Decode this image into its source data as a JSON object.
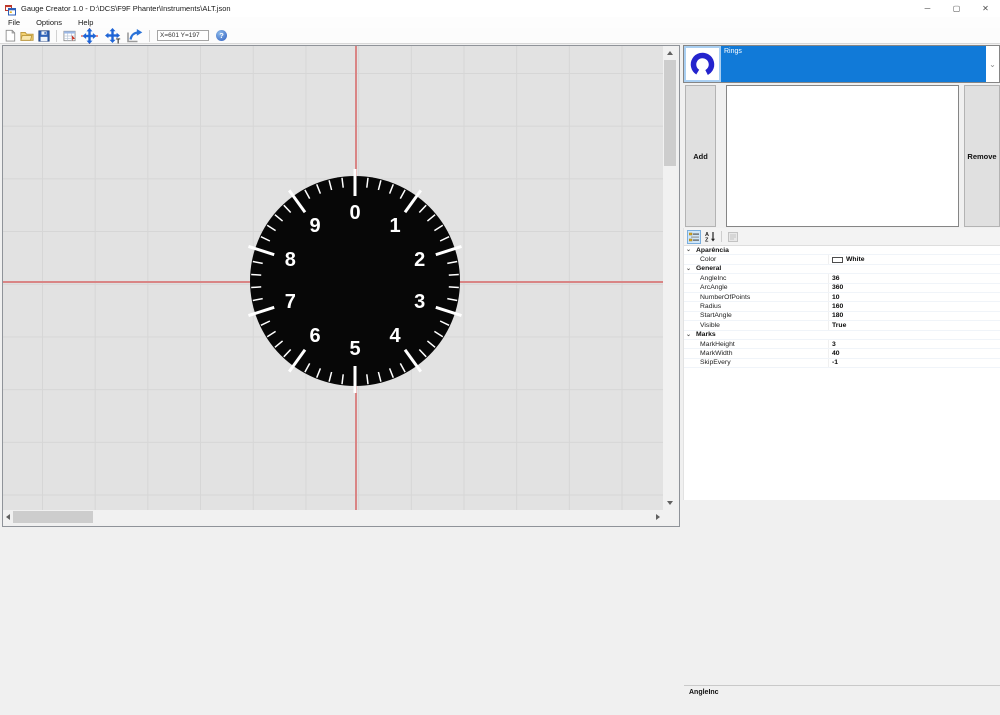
{
  "window": {
    "title": "Gauge Creator 1.0 - D:\\DCS\\F9F Phanter\\Instruments\\ALT.json",
    "minimize": "─",
    "maximize": "▢",
    "close": "✕"
  },
  "menu": {
    "items": [
      "File",
      "Options",
      "Help"
    ]
  },
  "toolbar": {
    "coords": "X=601 Y=197"
  },
  "layer_list": {
    "selected_item": "Rings",
    "chevron": "⌄"
  },
  "buttons": {
    "add": "Add",
    "remove": "Remove"
  },
  "property_grid": {
    "groups": [
      {
        "name": "Aparência",
        "rows": [
          {
            "name": "Color",
            "value": "White",
            "swatch": "#ffffff"
          }
        ]
      },
      {
        "name": "General",
        "rows": [
          {
            "name": "AngleInc",
            "value": "36"
          },
          {
            "name": "ArcAngle",
            "value": "360"
          },
          {
            "name": "NumberOfPoints",
            "value": "10"
          },
          {
            "name": "Radius",
            "value": "160"
          },
          {
            "name": "StartAngle",
            "value": "180"
          },
          {
            "name": "Visible",
            "value": "True"
          }
        ]
      },
      {
        "name": "Marks",
        "rows": [
          {
            "name": "MarkHeight",
            "value": "3"
          },
          {
            "name": "MarkWidth",
            "value": "40"
          },
          {
            "name": "SkipEvery",
            "value": "-1"
          }
        ]
      }
    ],
    "help_text": "AngleInc"
  },
  "gauge": {
    "labels": [
      "0",
      "1",
      "2",
      "3",
      "4",
      "5",
      "6",
      "7",
      "8",
      "9"
    ],
    "tick_count": 50,
    "major_every": 5,
    "dial_color": "#070707",
    "tick_color": "#ffffff",
    "label_color": "#ffffff"
  },
  "colors": {
    "selection": "#117ad8",
    "crosshair": "#d98585",
    "ring_icon": "#2424cd"
  }
}
